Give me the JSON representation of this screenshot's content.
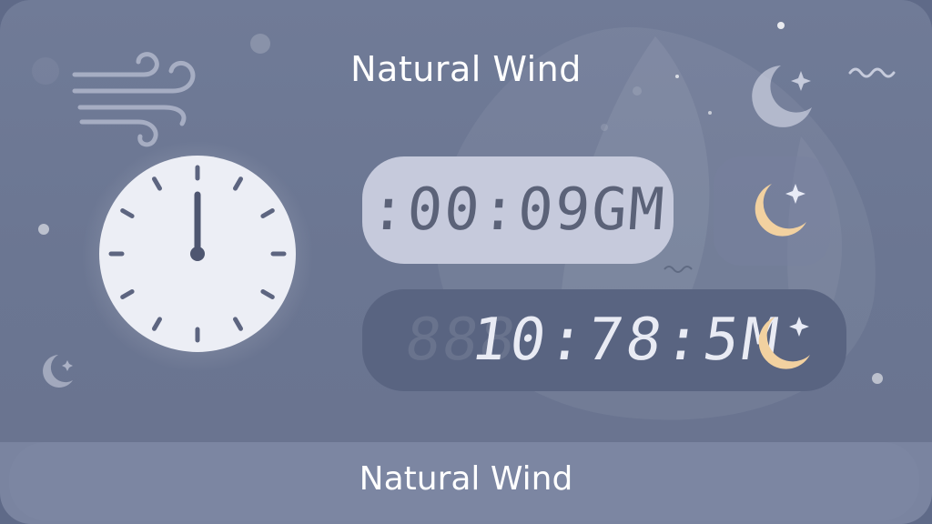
{
  "header": {
    "title": "Natural Wind"
  },
  "timer": {
    "display_primary": ":00:09GM",
    "display_secondary": "10:78:5M",
    "display_secondary_ghost": "888"
  },
  "footer": {
    "mode_label": "Natural Wind"
  },
  "icons": {
    "wind": "wind-icon",
    "clock": "clock-icon",
    "moon_primary": "moon-icon",
    "moon_secondary": "moon-icon",
    "moon_decor_top": "moon-icon",
    "moon_decor_left": "moon-icon",
    "wave": "wave-icon"
  },
  "colors": {
    "background": "#6b7692",
    "display_light": "#c6cadc",
    "display_dark": "#596481",
    "moon": "#f1cf9c",
    "text": "#ffffff"
  }
}
